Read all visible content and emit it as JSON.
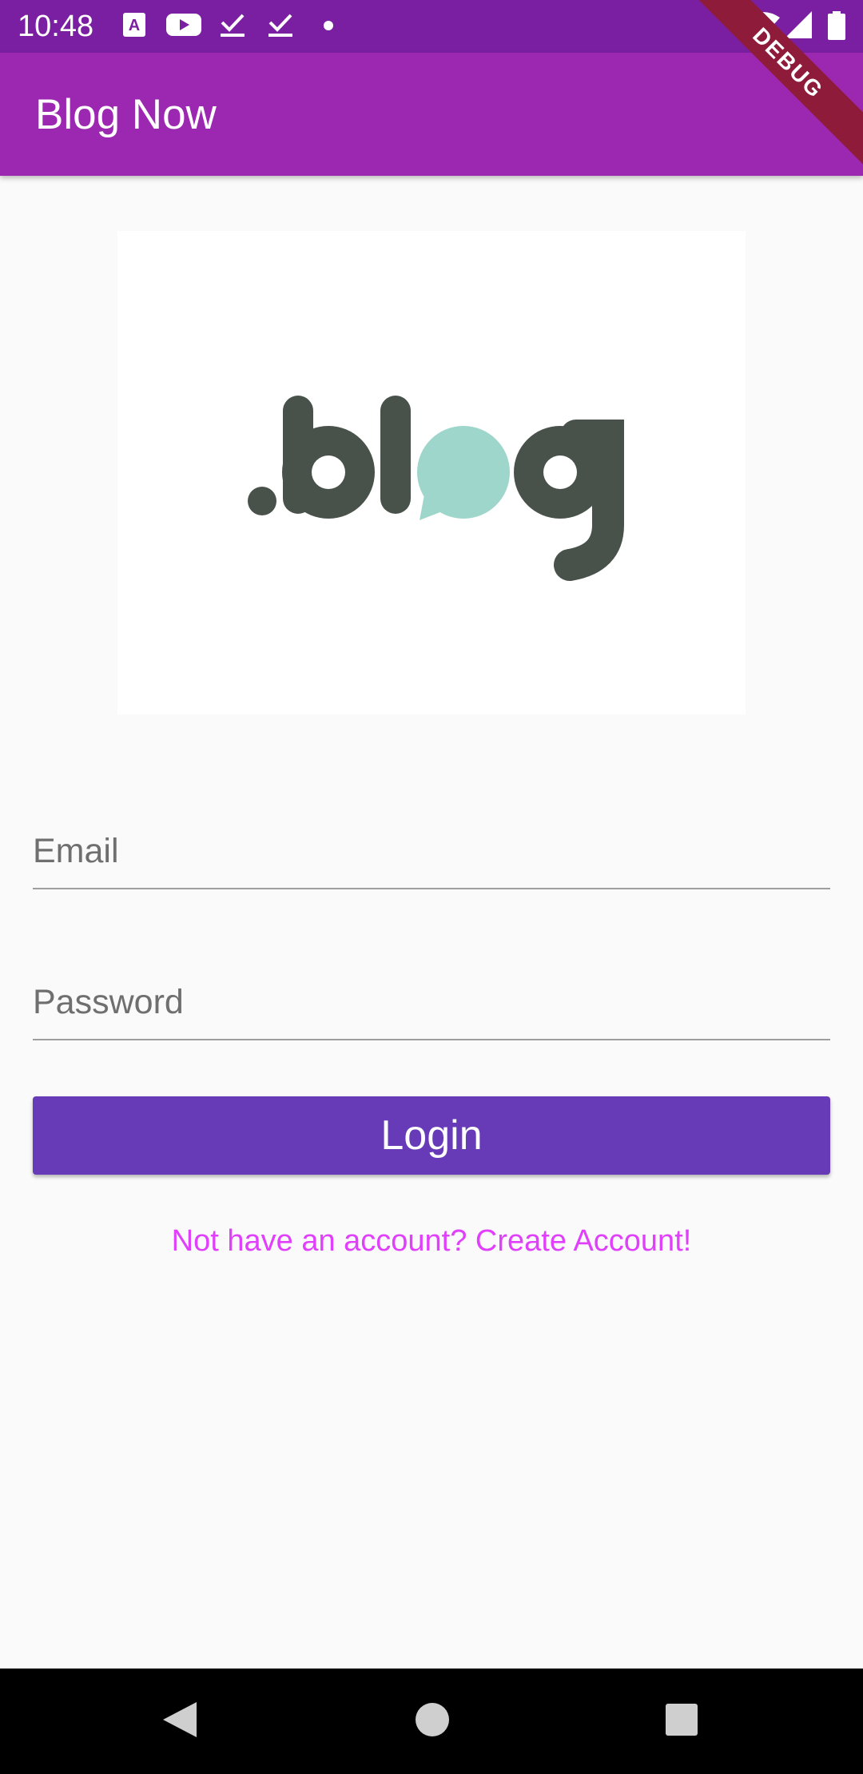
{
  "status_bar": {
    "time": "10:48",
    "left_icons": [
      "font-a-icon",
      "youtube-icon",
      "download-done-icon",
      "download-done-icon",
      "dot-icon"
    ],
    "right_icons": [
      "wifi-icon",
      "cell-signal-icon",
      "battery-icon"
    ]
  },
  "debug_banner": {
    "label": "DEBUG"
  },
  "app_bar": {
    "title": "Blog Now",
    "background": "#9c27b0"
  },
  "logo": {
    "word": ".blog",
    "dark_color": "#48524a",
    "bubble_color": "#9fd6cc"
  },
  "form": {
    "email": {
      "placeholder": "Email",
      "value": ""
    },
    "password": {
      "placeholder": "Password",
      "value": ""
    },
    "login_label": "Login",
    "login_color": "#673ab7",
    "signup_link": "Not have an account? Create Account!",
    "link_color": "#e040fb"
  },
  "nav_bar": {
    "buttons": [
      "back-icon",
      "home-icon",
      "recents-icon"
    ]
  }
}
